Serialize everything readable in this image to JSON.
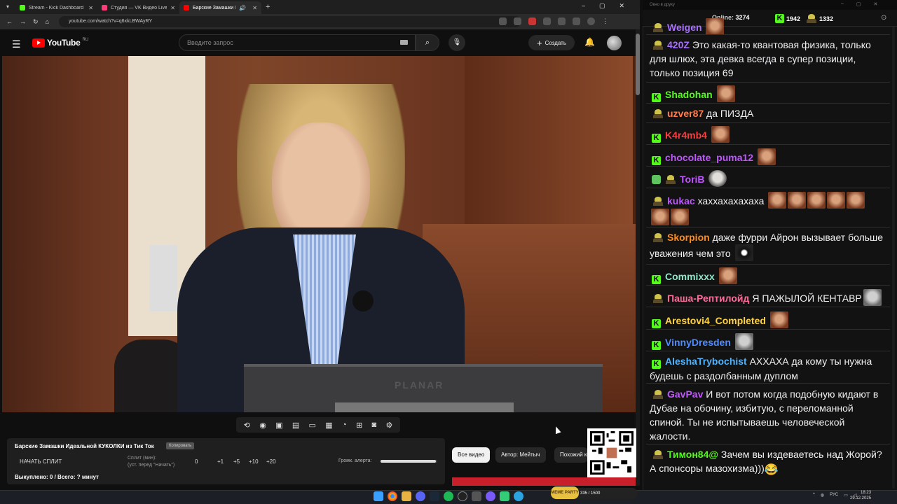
{
  "browser": {
    "tabs": [
      {
        "title": "Stream - Kick Dashboard",
        "color": "#53fc18"
      },
      {
        "title": "Студия — VK Видео Live",
        "color": "#ff3b7a"
      },
      {
        "title": "Барские Замашки Идеальн",
        "color": "#ff0000"
      }
    ],
    "url": "youtube.com/watch?v=q6xkLBWAyRY",
    "new_tab": "+"
  },
  "youtube": {
    "logo_text": "YouTube",
    "region": "RU",
    "search_placeholder": "Введите запрос",
    "create_label": "Создать",
    "video_watermark": "PLANAR",
    "filter_chips": [
      "Все видео",
      "Автор: Мейтыч",
      "Похожий контент"
    ]
  },
  "panel": {
    "title": "Барские Замашки Идеальной КУКОЛКИ из Тик Ток",
    "copy_label": "Копировать",
    "start_split": "НАЧАТЬ СПЛИТ",
    "split_label": "Сплит (мин):",
    "split_hint": "(уст. перед \"Начать\")",
    "split_value": "0",
    "increments": [
      "+1",
      "+5",
      "+10",
      "+20"
    ],
    "alert_volume_label": "Громк. алерта:",
    "alert_volume": 0.98,
    "bought_text": "Выкуплено: 0 / Всего: ? минут"
  },
  "chat": {
    "window_title": "Окно в друку",
    "online_label": "Online:",
    "online_count": "3274",
    "kick_count": "1942",
    "other_count": "1332",
    "messages": [
      {
        "badge": "p",
        "user": "Weigen",
        "color": "#a970ff",
        "text": "",
        "emotes": 1
      },
      {
        "badge": "p",
        "user": "420Z",
        "color": "#a970ff",
        "text": "Это какая-то квантовая физика, только для шлюх, эта девка всегда в супер позиции, только позиция 69",
        "emotes": 0
      },
      {
        "badge": "k",
        "user": "Shadohan",
        "color": "#53fc18",
        "text": "",
        "emotes": 1
      },
      {
        "badge": "p",
        "user": "uzver87",
        "color": "#ff7f50",
        "text": "да ПИЗДА",
        "emotes": 0
      },
      {
        "badge": "k",
        "user": "K4r4mb4",
        "color": "#ff3b3b",
        "text": "",
        "emotes": 1
      },
      {
        "badge": "k",
        "user": "chocolate_puma12",
        "color": "#c056ff",
        "text": "",
        "emotes": 1
      },
      {
        "badge": "g",
        "user": "ToriB",
        "color": "#c056ff",
        "text": "",
        "emotes": 1
      },
      {
        "badge": "p",
        "user": "kukac",
        "color": "#c056ff",
        "text": "хаххахахахаха",
        "emotes": 7
      },
      {
        "badge": "p",
        "user": "Skorpion",
        "color": "#ff8c1a",
        "text": "даже фурри Айрон вызывает больше уважения чем это",
        "emotes": 1
      },
      {
        "badge": "k",
        "user": "Commixxx",
        "color": "#8be9c8",
        "text": "",
        "emotes": 1
      },
      {
        "badge": "p",
        "user": "Паша-Рептилойд",
        "color": "#ff6b9a",
        "text": "Я ПАЖЫЛОЙ КЕНТАВР",
        "emotes": 1
      },
      {
        "badge": "k",
        "user": "Arestovi4_Completed",
        "color": "#ffd23f",
        "text": "",
        "emotes": 1
      },
      {
        "badge": "k",
        "user": "VinnyDresden",
        "color": "#4f8bff",
        "text": "",
        "emotes": 1
      },
      {
        "badge": "k",
        "user": "AleshaTrybochist",
        "color": "#4fb3ff",
        "text": "АХХАХА да кому ты нужна будешь с раздолбанным дуплом",
        "emotes": 0
      },
      {
        "badge": "p",
        "user": "GavPav",
        "color": "#c056ff",
        "text": "И вот потом когда подобную кидают в Дубае на обочину, избитую, с переломанной спиной. Ты не испытываешь человеческой жалости.",
        "emotes": 0
      },
      {
        "badge": "p",
        "user": "Тимон84@",
        "color": "#53fc18",
        "text": "Зачем вы издеваетесь над Жорой? А спонсоры мазохизма)))",
        "emotes": 0
      }
    ]
  },
  "taskbar": {
    "widget": "335 / 1500",
    "widget_brand": "MEME PARTY",
    "lang": "РУС",
    "time": "18:23",
    "date": "29.12.2025"
  }
}
